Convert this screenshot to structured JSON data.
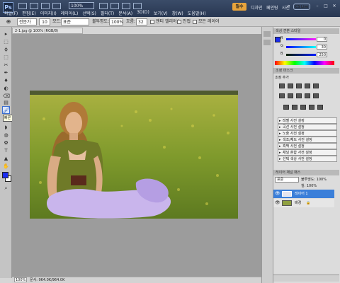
{
  "app": {
    "logo": "Ps"
  },
  "menu": [
    "파일(F)",
    "편집(E)",
    "이미지(I)",
    "레이어(L)",
    "선택(S)",
    "필터(T)",
    "분석(A)",
    "3D(D)",
    "보기(V)",
    "창(W)",
    "도움말(H)"
  ],
  "zoom": "100%",
  "workspaces": {
    "active": "필수",
    "items": [
      "디자인",
      "페인팅",
      "사진"
    ],
    "more": "»",
    "cslive": "CS Live"
  },
  "window_controls": [
    "–",
    "□",
    "✕"
  ],
  "options": {
    "mode_icon": "⊕",
    "mode": "전문가",
    "brush": "10",
    "style_label": "모드:",
    "style": "표준",
    "opacity_label": "불투명도:",
    "opacity": "100%",
    "flow_label": "흐름:",
    "flow": "32",
    "sample_all": "앤티 앨리어스",
    "contiguous": "인접",
    "all_layers": "모든 레이어"
  },
  "document": {
    "tab": "2-1.jpg @ 100% (RGB/8)",
    "status_zoom": "100%",
    "status_doc": "문서: 964.0K/964.0K"
  },
  "tools": {
    "glyphs": [
      "▸",
      "⬚",
      "ϕ",
      "⬚",
      "✂",
      "✒",
      "♦",
      "◐",
      "⌫",
      "▤",
      "◗",
      "◍",
      "✿",
      "T",
      "▲",
      "✋",
      "⌕"
    ],
    "quick_select": "🖌",
    "tooltip": "빠른 선택 도구 (W)"
  },
  "panels": {
    "color_tab": "색상 견본 스타일",
    "color": {
      "r": "0",
      "g": "30",
      "b": "250",
      "r_label": "R",
      "g_label": "G",
      "b_label": "B"
    },
    "adjust_tab": "조정 마스크",
    "adjust_title": "조정 추가",
    "adjust_presets": [
      "레벨 사전 설정",
      "곡선 사전 설정",
      "노출 사전 설정",
      "색조/채도 사전 설정",
      "흑백 사전 설정",
      "채널 혼합 사전 설정",
      "선택 색상 사전 설정"
    ],
    "layers_tab": "레이어 채널 패스",
    "layers_mode": "표준",
    "layers_opacity": "불투명도: 100%",
    "layers_fill": "칠: 100%",
    "layers": [
      {
        "name": "레이어 1",
        "selected": true
      },
      {
        "name": "배경",
        "selected": false
      }
    ]
  },
  "colors": {
    "accent": "#3b6fd1",
    "fg": "#1a2cf0",
    "bg": "#ffffff",
    "workspace_active": "#e8a43c"
  }
}
